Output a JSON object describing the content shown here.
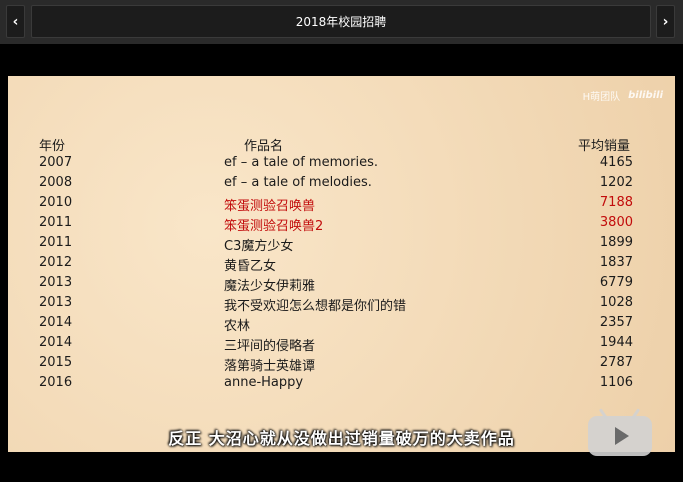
{
  "header": {
    "title": "2018年校园招聘",
    "prev_icon": "‹",
    "next_icon": "›"
  },
  "watermark": {
    "team": "H萌团队",
    "brand": "bilibili"
  },
  "table": {
    "headers": {
      "year": "年份",
      "title": "作品名",
      "sales": "平均销量"
    },
    "rows": [
      {
        "year": "2007",
        "title": "ef – a tale of memories.",
        "sales": "4165",
        "highlight": false
      },
      {
        "year": "2008",
        "title": "ef – a tale of melodies.",
        "sales": "1202",
        "highlight": false
      },
      {
        "year": "2010",
        "title": "笨蛋测验召唤兽",
        "sales": "7188",
        "highlight": true
      },
      {
        "year": "2011",
        "title": "笨蛋测验召唤兽2",
        "sales": "3800",
        "highlight": true
      },
      {
        "year": "2011",
        "title": "C3魔方少女",
        "sales": "1899",
        "highlight": false
      },
      {
        "year": "2012",
        "title": "黄昏乙女",
        "sales": "1837",
        "highlight": false
      },
      {
        "year": "2013",
        "title": "魔法少女伊莉雅",
        "sales": "6779",
        "highlight": false
      },
      {
        "year": "2013",
        "title": "我不受欢迎怎么想都是你们的错",
        "sales": "1028",
        "highlight": false
      },
      {
        "year": "2014",
        "title": "农林",
        "sales": "2357",
        "highlight": false
      },
      {
        "year": "2014",
        "title": "三坪间的侵略者",
        "sales": "1944",
        "highlight": false
      },
      {
        "year": "2015",
        "title": "落第骑士英雄谭",
        "sales": "2787",
        "highlight": false
      },
      {
        "year": "2016",
        "title": "anne-Happy",
        "sales": "1106",
        "highlight": false
      }
    ]
  },
  "subtitle": "反正 大沼心就从没做出过销量破万的大卖作品",
  "colors": {
    "highlight": "#c20c0c",
    "paper": "#f1d7b3"
  }
}
